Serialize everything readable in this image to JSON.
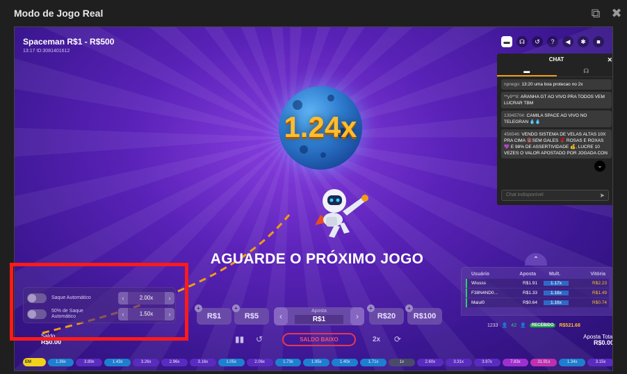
{
  "modal": {
    "title": "Modo de Jogo Real",
    "icons": [
      "external-link-icon",
      "close-icon"
    ]
  },
  "game": {
    "title": "Spaceman R$1 - R$500",
    "round_id": "13:17 ID:3081401612",
    "multiplier": "1.24x",
    "status_text": "AGUARDE O PRÓXIMO JOGO",
    "top_icons": [
      "chat-icon",
      "support-icon",
      "history-icon",
      "help-icon",
      "sound-icon",
      "settings-icon",
      "video-icon"
    ]
  },
  "chat": {
    "title": "CHAT",
    "messages": [
      {
        "user": "npnego:",
        "text": "13:20 uma boa protecao no 2x"
      },
      {
        "user": "**y9**8:",
        "text": "ARANHA GT   AO VIVO PRA TODOS VEM LUCRAR TBM"
      },
      {
        "user": "13945704:",
        "text": "CAMILA SPACE AO VIVO NO TELEGRAN 💧💧"
      },
      {
        "user": "456546:",
        "text": "VENDO SISTEMA DE VELAS ALTAS 10X PRA CIMA 🔞SEM GALES 🌹 ROSAS E ROXAS 💜 E 98% DE ASSERTIVIDADE 💰, LUCRE 10 VEZES O VALOR APOSTADO POR JOGADA CON"
      }
    ],
    "input_placeholder": "Chat indisponível"
  },
  "autoplay": {
    "auto_cashout_label": "Saque Automático",
    "auto_cashout_value": "2.00x",
    "half_cashout_label": "50% de Saque Automático",
    "half_cashout_value": "1.50x"
  },
  "balance": {
    "label": "Saldo",
    "value": "R$0.00"
  },
  "bet": {
    "chips": [
      "R$1",
      "R$5",
      "R$20",
      "R$100"
    ],
    "label": "Aposta",
    "value": "R$1",
    "low_balance_button": "SALDO BAIXO",
    "double_label": "2x"
  },
  "bets_table": {
    "headers": [
      "Usuário",
      "Aposta",
      "Mult.",
      "Vitória"
    ],
    "rows": [
      {
        "user": "Wiusss",
        "bet": "R$1.91",
        "mult": "1.17x",
        "win": "R$2.23"
      },
      {
        "user": "F38N4ND0...",
        "bet": "R$1.33",
        "mult": "1.16x",
        "win": "R$1.49"
      },
      {
        "user": "Maiul0",
        "bet": "R$0.64",
        "mult": "1.16x",
        "win": "R$0.74"
      }
    ],
    "players": "1233",
    "winners": "42",
    "received_label": "RECEBIDO",
    "received_value": "R$521.68",
    "total_label": "Aposta Total",
    "total_value": "R$0.00"
  },
  "history": {
    "badge": "EM JOGO",
    "items": [
      {
        "v": "1.36x",
        "c": "#1e7fd0"
      },
      {
        "v": "3.89x",
        "c": "#5a2bc0"
      },
      {
        "v": "1.43x",
        "c": "#1e7fd0"
      },
      {
        "v": "3.26x",
        "c": "#5a2bc0"
      },
      {
        "v": "2.96x",
        "c": "#5a2bc0"
      },
      {
        "v": "3.16x",
        "c": "#5a2bc0"
      },
      {
        "v": "1.05x",
        "c": "#1e7fd0"
      },
      {
        "v": "2.06x",
        "c": "#5a2bc0"
      },
      {
        "v": "1.73x",
        "c": "#1e7fd0"
      },
      {
        "v": "1.95x",
        "c": "#1e7fd0"
      },
      {
        "v": "1.40x",
        "c": "#1e7fd0"
      },
      {
        "v": "1.71x",
        "c": "#1e7fd0"
      },
      {
        "v": "1x",
        "c": "#4a4a6a"
      },
      {
        "v": "2.60x",
        "c": "#5a2bc0"
      },
      {
        "v": "3.31x",
        "c": "#5a2bc0"
      },
      {
        "v": "3.97x",
        "c": "#5a2bc0"
      },
      {
        "v": "7.83x",
        "c": "#a02fd0"
      },
      {
        "v": "31.91x",
        "c": "#c02fb0"
      },
      {
        "v": "1.34x",
        "c": "#1e7fd0"
      },
      {
        "v": "3.15x",
        "c": "#5a2bc0"
      }
    ]
  }
}
